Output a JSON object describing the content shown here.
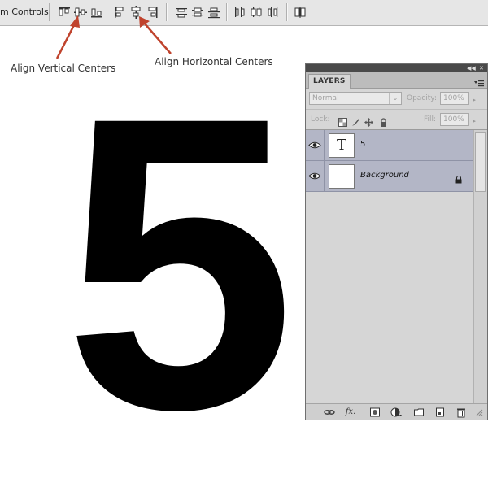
{
  "toolbar": {
    "label": "m Controls",
    "icons": [
      "align-top-edges-icon",
      "align-vertical-centers-icon",
      "align-bottom-edges-icon",
      "align-left-edges-icon",
      "align-horizontal-centers-icon",
      "align-right-edges-icon",
      "distribute-top-edges-icon",
      "distribute-vertical-centers-icon",
      "distribute-bottom-edges-icon",
      "distribute-left-edges-icon",
      "distribute-horizontal-centers-icon",
      "distribute-right-edges-icon",
      "auto-align-layers-icon"
    ]
  },
  "annotations": {
    "vertical_label": "Align Vertical Centers",
    "horizontal_label": "Align Horizontal Centers",
    "arrow_color": "#c0432d"
  },
  "canvas": {
    "digit": "5"
  },
  "layers_panel": {
    "tab_label": "LAYERS",
    "blend_mode": "Normal",
    "opacity_label": "Opacity:",
    "opacity_value": "100%",
    "lock_label": "Lock:",
    "fill_label": "Fill:",
    "fill_value": "100%",
    "layers": [
      {
        "name": "5",
        "thumbnail_text": "T",
        "type": "text",
        "visible": true,
        "selected": true
      },
      {
        "name": "Background",
        "thumbnail_text": "",
        "type": "background",
        "visible": true,
        "locked": true
      }
    ],
    "bottom_icons": [
      "link-layers-icon",
      "fx-icon",
      "add-mask-icon",
      "adjustment-layer-icon",
      "new-group-icon",
      "new-layer-icon",
      "delete-layer-icon"
    ],
    "fx_text": "fx.",
    "selected_color": "#b3b6c6"
  }
}
